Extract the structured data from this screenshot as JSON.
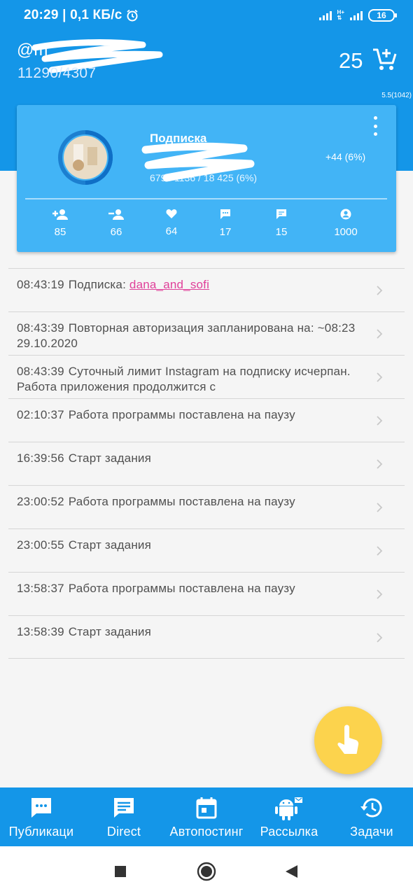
{
  "status_bar": {
    "time_speed": "20:29 | 0,1 КБ/с",
    "network": "H+",
    "battery": "16"
  },
  "header": {
    "username": "@m",
    "counts": "11290/4307",
    "cart_count": "25",
    "version": "5.5(1042)"
  },
  "stats_card": {
    "title": "Подписка",
    "stats_line": "679 / 1136 / 18 425 (6%)",
    "delta": "+44 (6%)",
    "metrics": [
      {
        "icon": "person-add-icon",
        "value": "85"
      },
      {
        "icon": "person-remove-icon",
        "value": "66"
      },
      {
        "icon": "heart-icon",
        "value": "64"
      },
      {
        "icon": "comment-icon",
        "value": "17"
      },
      {
        "icon": "direct-message-icon",
        "value": "15"
      },
      {
        "icon": "account-circle-icon",
        "value": "1000"
      }
    ]
  },
  "log": [
    {
      "time": "08:43:19",
      "text": "Подписка: ",
      "link": "dana_and_sofi"
    },
    {
      "time": "08:43:39",
      "text": "Повторная авторизация запланирована на: ~08:23 29.10.2020",
      "link": ""
    },
    {
      "time": "08:43:39",
      "text": "Суточный лимит Instagram на подписку исчерпан. Работа приложения продолжится с",
      "link": ""
    },
    {
      "time": "02:10:37",
      "text": "Работа программы поставлена на паузу",
      "link": ""
    },
    {
      "time": "16:39:56",
      "text": "Старт задания",
      "link": ""
    },
    {
      "time": "23:00:52",
      "text": "Работа программы поставлена на паузу",
      "link": ""
    },
    {
      "time": "23:00:55",
      "text": "Старт задания",
      "link": ""
    },
    {
      "time": "13:58:37",
      "text": "Работа программы поставлена на паузу",
      "link": ""
    },
    {
      "time": "13:58:39",
      "text": "Старт задания",
      "link": ""
    }
  ],
  "bottom_nav": [
    {
      "icon": "chat-bubble-icon",
      "label": "Публикаци"
    },
    {
      "icon": "message-icon",
      "label": "Direct"
    },
    {
      "icon": "calendar-icon",
      "label": "Автопостинг"
    },
    {
      "icon": "android-icon",
      "label": "Рассылка"
    },
    {
      "icon": "history-icon",
      "label": "Задачи"
    }
  ],
  "colors": {
    "primary": "#1496e8",
    "card": "#42b4f6",
    "fab": "#fcd34d",
    "link": "#e0409a"
  }
}
